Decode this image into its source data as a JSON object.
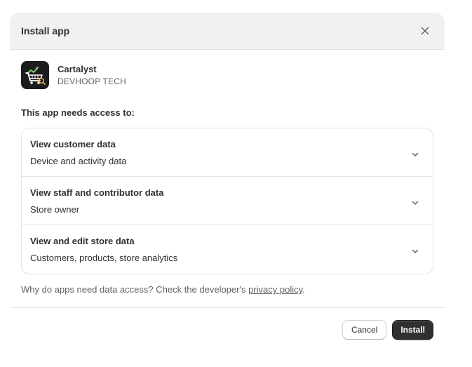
{
  "modal": {
    "title": "Install app",
    "close_icon": "close-icon"
  },
  "app": {
    "name": "Cartalyst",
    "developer": "DEVHOOP TECH",
    "icon": "shopping-cart-analytics-icon"
  },
  "access": {
    "heading": "This app needs access to:",
    "items": [
      {
        "title": "View customer data",
        "description": "Device and activity data"
      },
      {
        "title": "View staff and contributor data",
        "description": "Store owner"
      },
      {
        "title": "View and edit store data",
        "description": "Customers, products, store analytics"
      }
    ]
  },
  "footnote": {
    "text": "Why do apps need data access? Check the developer's ",
    "link": "privacy policy",
    "suffix": "."
  },
  "footer": {
    "cancel_label": "Cancel",
    "install_label": "Install"
  },
  "colors": {
    "header_bg": "#f1f1f1",
    "primary_button": "#303030",
    "app_icon_bg": "#1c1c1c",
    "chart_accent": "#7cd36b"
  }
}
